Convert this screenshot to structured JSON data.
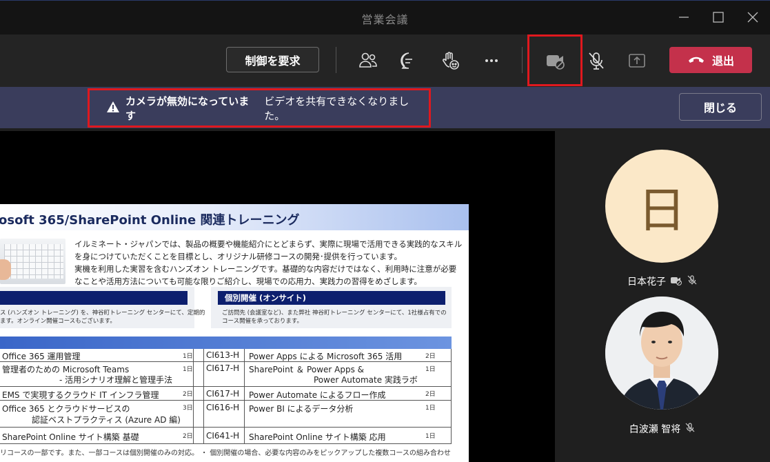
{
  "window": {
    "title": "営業会議"
  },
  "toolbar": {
    "request_control_label": "制御を要求",
    "leave_label": "退出"
  },
  "notification": {
    "title": "カメラが無効になっています",
    "message": "ビデオを共有できなくなりました。",
    "close_label": "閉じる"
  },
  "shared_content": {
    "title": "osoft 365/SharePoint Online 関連トレーニング",
    "intro": [
      "イルミネート・ジャパンでは、製品の概要や機能紹介にとどまらず、実際に現場で活用できる実践的なスキル",
      "を身につけていただくことを目標とし、オリジナル研修コースの開発･提供を行っています。",
      "実機を利用した実習を含むハンズオン トレーニングです。基礎的な内容だけではなく、利用時に注意が必要",
      "なことや活用方法についても可能な限りご紹介し、現場での応用力、実践力の習得をめざします。"
    ],
    "panel_left": {
      "heading": "",
      "text": [
        "ス (ハンズオン トレーニング) を、神谷町トレーニング センターにて、定期的",
        "ます。オンライン開催コースもございます。"
      ]
    },
    "panel_right": {
      "heading": "個別開催 (オンサイト)",
      "text": [
        "ご訪問先 (会議室など)、また弊社 神谷町トレーニング センターにて、1社様占有での",
        "コース開催を承っております。"
      ]
    },
    "courses_left": [
      {
        "lines": [
          "Office 365 運用管理"
        ],
        "days": "1日"
      },
      {
        "lines": [
          "管理者のための Microsoft Teams",
          "- 活用シナリオ理解と管理手法"
        ],
        "days": "1日"
      },
      {
        "lines": [
          "EMS で実現するクラウド IT インフラ管理"
        ],
        "days": "2日"
      },
      {
        "lines": [
          "Office 365 とクラウドサービスの",
          "認証ベストプラクティス (Azure AD 編)"
        ],
        "days": "3日"
      },
      {
        "lines": [
          "SharePoint Online サイト構築 基礎"
        ],
        "days": "2日"
      }
    ],
    "courses_right": [
      {
        "code": "CI613-H",
        "lines": [
          "Power Apps による Microsoft 365 活用"
        ],
        "days": "2日"
      },
      {
        "code": "CI617-H",
        "lines": [
          "SharePoint ＆ Power Apps &",
          "Power Automate 実践ラボ"
        ],
        "days": "1日"
      },
      {
        "code": "CI617-H",
        "lines": [
          "Power Automate によるフロー作成"
        ],
        "days": "2日"
      },
      {
        "code": "CI616-H",
        "lines": [
          "Power BI によるデータ分析"
        ],
        "days": "1日"
      },
      {
        "code": "CI641-H",
        "lines": [
          "SharePoint Online サイト構築 応用"
        ],
        "days": "1日"
      }
    ],
    "footer": "リコースの一部です。また、一部コースは個別開催のみの対応。   ・ 個別開催の場合、必要な内容のみをピックアップした複数コースの組み合わせ"
  },
  "participants": [
    {
      "initial": "日",
      "name": "日本花子",
      "avatar_bg": "#fbe8c8"
    },
    {
      "name": "白波瀬 智将"
    }
  ],
  "colors": {
    "highlight": "#e0181e",
    "leave": "#c4314b",
    "notice_bg": "#3a3d5c",
    "doc_navy": "#0d1f6e"
  },
  "icons": [
    "minimize-icon",
    "maximize-icon",
    "close-window-icon",
    "people-icon",
    "chat-icon",
    "raise-hand-icon",
    "more-icon",
    "camera-off-icon",
    "mic-off-icon",
    "share-tray-icon",
    "phone-hangup-icon",
    "warning-icon"
  ]
}
